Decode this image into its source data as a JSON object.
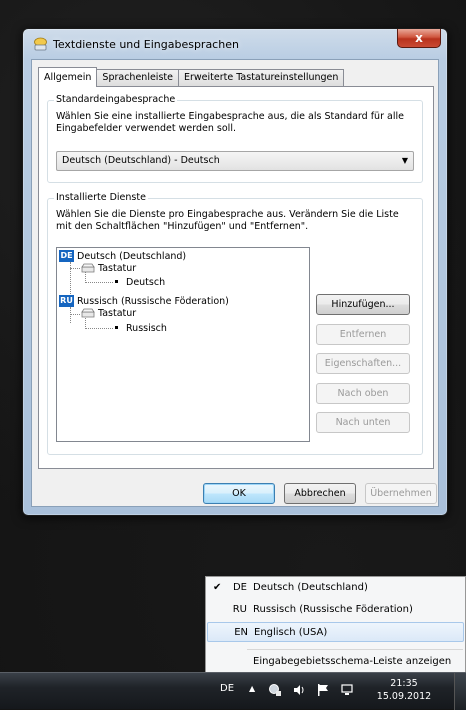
{
  "window": {
    "title": "Textdienste und Eingabesprachen",
    "close_label": "x"
  },
  "tabs": [
    {
      "label": "Allgemein",
      "active": true
    },
    {
      "label": "Sprachenleiste",
      "active": false
    },
    {
      "label": "Erweiterte Tastatureinstellungen",
      "active": false
    }
  ],
  "default_language": {
    "legend": "Standardeingabesprache",
    "description_line1": "Wählen Sie eine installierte Eingabesprache aus, die als Standard für alle",
    "description_line2": "Eingabefelder verwendet werden soll.",
    "selected_value": "Deutsch (Deutschland) - Deutsch"
  },
  "installed_services": {
    "legend": "Installierte Dienste",
    "description_line1": "Wählen Sie die Dienste pro Eingabesprache aus. Verändern Sie die Liste",
    "description_line2": "mit den Schaltflächen \"Hinzufügen\" und \"Entfernen\".",
    "tree": {
      "lang1_code": "DE",
      "lang1_name": "Deutsch (Deutschland)",
      "lang1_category": "Tastatur",
      "lang1_layout": "Deutsch",
      "lang2_code": "RU",
      "lang2_name": "Russisch (Russische Föderation)",
      "lang2_category": "Tastatur",
      "lang2_layout": "Russisch"
    },
    "buttons": {
      "add": "Hinzufügen...",
      "remove": "Entfernen",
      "properties": "Eigenschaften...",
      "move_up": "Nach oben",
      "move_down": "Nach unten"
    }
  },
  "dialog_buttons": {
    "ok": "OK",
    "cancel": "Abbrechen",
    "apply": "Übernehmen"
  },
  "language_menu": {
    "items": [
      {
        "check": "✔",
        "code": "DE",
        "label": "Deutsch (Deutschland)",
        "checked": true
      },
      {
        "check": "",
        "code": "RU",
        "label": "Russisch (Russische Föderation)",
        "checked": false
      },
      {
        "check": "",
        "code": "EN",
        "label": "Englisch (USA)",
        "highlighted": true
      }
    ],
    "footer": "Eingabegebietsschema-Leiste anzeigen"
  },
  "taskbar": {
    "language": "DE",
    "time": "21:35",
    "date": "15.09.2012",
    "icons": [
      "chevron-up-icon",
      "network-icon",
      "volume-icon",
      "flag-icon",
      "action-center-icon"
    ]
  },
  "colors": {
    "selection_badge": "#1565c0",
    "menu_highlight": "#dbe9f8"
  }
}
